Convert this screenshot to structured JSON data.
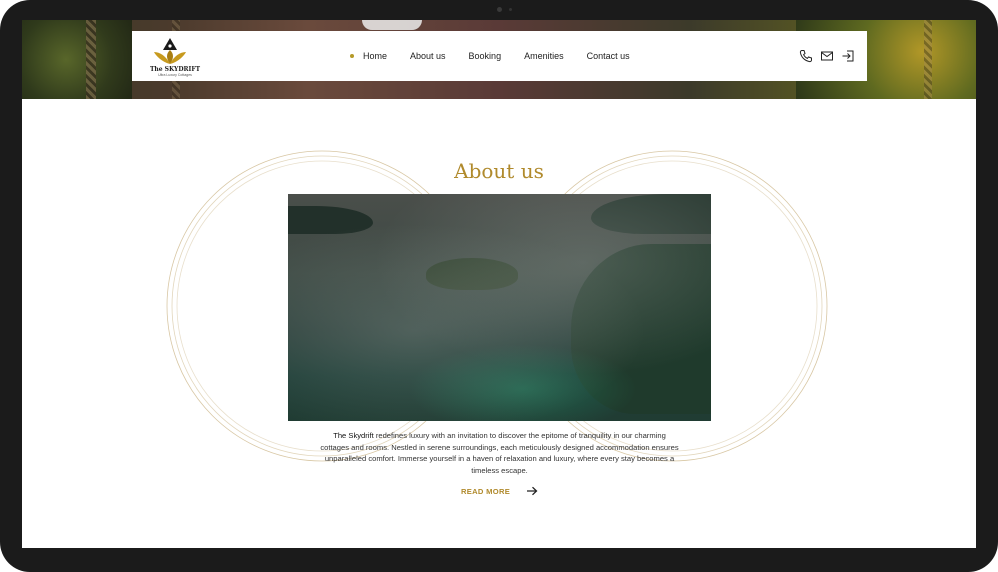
{
  "brand": {
    "name": "The SKYDRIFT",
    "tagline": "Ultra Luxury Cottages",
    "accent_color": "#b08a2c"
  },
  "nav": {
    "items": [
      {
        "label": "Home",
        "active": true
      },
      {
        "label": "About us",
        "active": false
      },
      {
        "label": "Booking",
        "active": false
      },
      {
        "label": "Amenities",
        "active": false
      },
      {
        "label": "Contact us",
        "active": false
      }
    ],
    "icons": [
      "phone-icon",
      "mail-icon",
      "login-icon"
    ]
  },
  "about": {
    "title": "About us",
    "description_brand": "The Skydrift",
    "description_rest": " redefines luxury with an invitation to discover the epitome of tranquility in our charming cottages and rooms. Nestled in serene surroundings, each meticulously designed accommodation ensures unparalleled comfort. Immerse yourself in a haven of relaxation and luxury, where every stay becomes a timeless escape.",
    "read_more": "READ MORE"
  }
}
